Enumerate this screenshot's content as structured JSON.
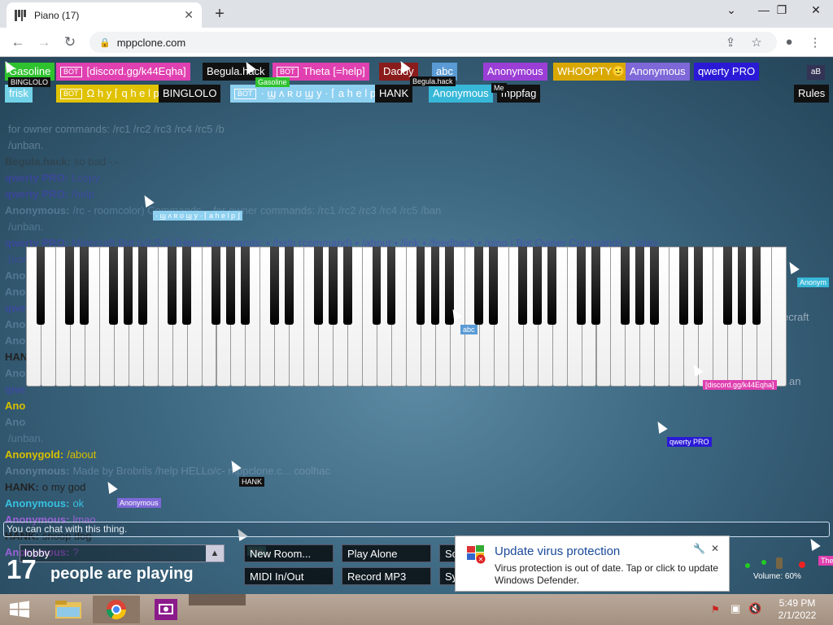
{
  "browser": {
    "tab_title": "Piano (17)",
    "tab_close": "✕",
    "new_tab": "+",
    "url": "mppclone.com",
    "win_chevron": "⌄",
    "win_min": "—",
    "win_max": "❐",
    "win_close": "✕"
  },
  "top_users_row1": [
    {
      "name": "Gasoline",
      "color": "#2fc22f",
      "bot": false
    },
    {
      "name": "[discord.gg/k44Eqha]",
      "color": "#e040b0",
      "bot": true
    },
    {
      "name": "Begula.hack",
      "color": "#111111",
      "bot": false
    },
    {
      "name": "Theta [=help]",
      "color": "#e040b0",
      "bot": true
    },
    {
      "name": "Daddy",
      "color": "#8a1c1c",
      "bot": false
    },
    {
      "name": "abc",
      "color": "#5b9bd5",
      "bot": false
    },
    {
      "name": "Anonymous",
      "color": "#9b3ed6",
      "bot": false
    },
    {
      "name": "WHOOPTY🙂",
      "color": "#d9a800",
      "bot": false
    },
    {
      "name": "Anonymous",
      "color": "#7e68d8",
      "bot": false
    },
    {
      "name": "qwerty PRO",
      "color": "#2a1ad6",
      "bot": false
    }
  ],
  "top_users_row2": [
    {
      "name": "frisk",
      "color": "#72d2e8",
      "bot": false
    },
    {
      "name": "Ω h y ⌈ q h e l p ⌋",
      "color": "#e0c200",
      "bot": true
    },
    {
      "name": "BINGLOLO",
      "color": "#111111",
      "bot": false
    },
    {
      "name": "· ϣ ᴧ ʀ ʊ ϣ y · ⌈ a h e l p ⌋",
      "color": "#8ed0f0",
      "bot": true
    },
    {
      "name": "HANK",
      "color": "#111111",
      "bot": false
    },
    {
      "name": "Anonymous",
      "color": "#38b8d8",
      "bot": false
    },
    {
      "name": "mppfag",
      "color": "#111111",
      "bot": false
    }
  ],
  "bot_badge": "BOT",
  "mini_tags": {
    "binglolo": "BINGLOLO",
    "gasoline": "Gasoline",
    "begula": "Begula.hack",
    "me": "Me",
    "wrowy": "· ϣ ᴧ ʀ ʊ ϣ y · ⌈ a h e l p ⌋",
    "anon_right": "Anonym",
    "abc": "abc",
    "discord": "[discord.gg/k44Eqha]",
    "qwerty": "qwerty PRO",
    "hank": "HANK",
    "anon_bottom": "Anonymous",
    "frisk": "frisk",
    "the": "The"
  },
  "rules_label": "Rules",
  "avatar_label": "aB",
  "chat": [
    {
      "user": "",
      "msg": "for owner commands: /rc1 /rc2 /rc3 /rc4 /rc5 /b",
      "color": "#9fb8cc",
      "faded": true
    },
    {
      "user": "",
      "msg": "/unban.",
      "color": "#9fb8cc",
      "faded": true
    },
    {
      "user": "Begula.hack:",
      "msg": "so bad -.-",
      "color": "#333333",
      "faded": true
    },
    {
      "user": "qwerty PRO:",
      "msg": "Lcopy",
      "color": "#4a3ad0",
      "faded": true
    },
    {
      "user": "qwerty PRO:",
      "msg": "/help",
      "color": "#4a3ad0",
      "faded": true
    },
    {
      "user": "Anonymous:",
      "msg": "/rc - roomcolor) Commands... for owner commands: /rc1 /rc2 /rc3 /rc4 /rc5 /ban",
      "color": "#7aa0c0",
      "faded": true
    },
    {
      "user": "",
      "msg": "/unban.",
      "color": "#7aa0c0",
      "faded": true
    },
    {
      "user": "qwerty PRO:",
      "msg": "Minecraft Bot (v2.5.0) [Help] Commands: • /help (command) • /about • /link • /feedback • /ping | Bot Owner Commands: • /play",
      "color": "#4a3ad0",
      "faded": true
    },
    {
      "user": "",
      "msg": "(song) • /skip • /stop • /p... /song • /repeat • /sustain • /autoplay (choice) • /album • /art (choice) • /minecraft",
      "color": "#4a3ad0",
      "faded": true
    },
    {
      "user": "Anonymous:",
      "msg": "/ban",
      "color": "#7aa0c0",
      "faded": true
    },
    {
      "user": "Anonymous:",
      "msg": "",
      "color": "#7aa0c0",
      "faded": true
    },
    {
      "user": "qwe",
      "msg": "",
      "color": "#4a3ad0",
      "faded": true
    },
    {
      "user": "Ano",
      "msg": "",
      "color": "#7aa0c0",
      "faded": true
    },
    {
      "user": "Ano",
      "msg": "",
      "color": "#7aa0c0",
      "faded": true
    },
    {
      "user": "HAN",
      "msg": "",
      "color": "#222222",
      "faded": false
    },
    {
      "user": "Ano",
      "msg": "",
      "color": "#7aa0c0",
      "faded": true
    },
    {
      "user": "qwe",
      "msg": "",
      "color": "#4a3ad0",
      "faded": true
    },
    {
      "user": "Ano",
      "msg": "",
      "color": "#d8c000",
      "faded": false
    },
    {
      "user": "Ano",
      "msg": "",
      "color": "#7aa0c0",
      "faded": true
    },
    {
      "user": "",
      "msg": "/unban.",
      "color": "#7aa0c0",
      "faded": true
    },
    {
      "user": "Anonygold:",
      "msg": "/about",
      "color": "#d8c000",
      "faded": false
    },
    {
      "user": "Anonymous:",
      "msg": "Made by Brobrils /help HELLo/c- mppclone.c... coolhac",
      "color": "#8fa8c8",
      "faded": true
    },
    {
      "user": "HANK:",
      "msg": "o my god",
      "color": "#222222",
      "faded": false
    },
    {
      "user": "Anonymous:",
      "msg": "ok",
      "color": "#38c0e0",
      "faded": false
    },
    {
      "user": "Anonymous:",
      "msg": "lmao",
      "color": "#9b60d8",
      "faded": false
    },
    {
      "user": "HANK:",
      "msg": "snoop dog",
      "color": "#222222",
      "faded": false
    },
    {
      "user": "Anonymous:",
      "msg": "?",
      "color": "#9b60d8",
      "faded": false
    }
  ],
  "chat_right_fragments": {
    "minecraft": "ecraft",
    "an": "an"
  },
  "chat_input_placeholder": "You can chat with this thing.",
  "room": {
    "name": "lobby",
    "caret": "▲"
  },
  "people": {
    "count": "17",
    "label": "people are playing"
  },
  "buttons": {
    "new_room": "New Room...",
    "play_alone": "Play Alone",
    "midi": "MIDI In/Out",
    "record": "Record MP3",
    "so": "So",
    "sy": "Sy"
  },
  "volume": "Volume: 60%",
  "notification": {
    "title": "Update virus protection",
    "body": "Virus protection is out of date. Tap or click to update Windows Defender.",
    "pin": "🔧",
    "close": "✕"
  },
  "clock": {
    "time": "5:49 PM",
    "date": "2/1/2022"
  },
  "colors": {
    "notify_title": "#1a4a9a",
    "taskbar": "#a3907f"
  }
}
